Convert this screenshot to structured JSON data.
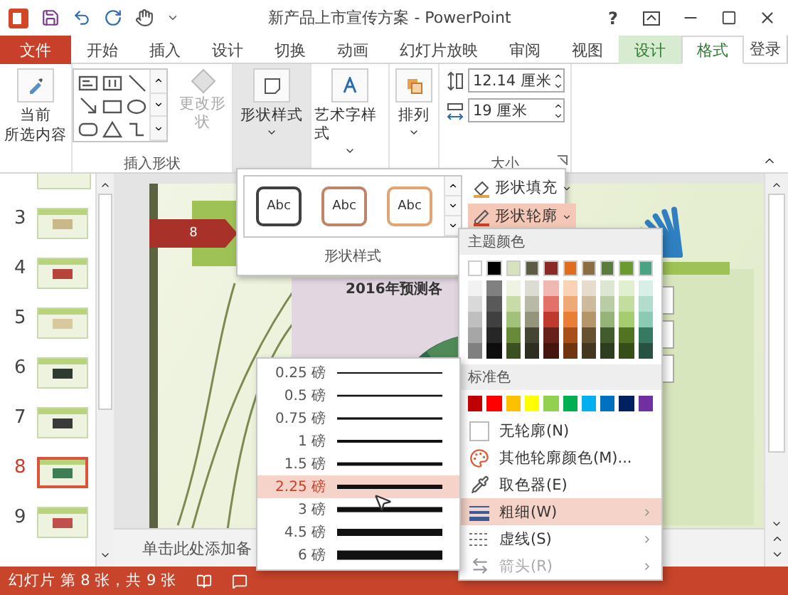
{
  "window": {
    "title": "新产品上市宣传方案 - PowerPoint",
    "help": "?"
  },
  "ribbon_tabs": [
    {
      "label": "文件",
      "kind": "file",
      "selected": false
    },
    {
      "label": "开始",
      "kind": "normal",
      "selected": false
    },
    {
      "label": "插入",
      "kind": "normal",
      "selected": false
    },
    {
      "label": "设计",
      "kind": "normal",
      "selected": false
    },
    {
      "label": "切换",
      "kind": "normal",
      "selected": false
    },
    {
      "label": "动画",
      "kind": "normal",
      "selected": false
    },
    {
      "label": "幻灯片放映",
      "kind": "normal",
      "selected": false
    },
    {
      "label": "审阅",
      "kind": "normal",
      "selected": false
    },
    {
      "label": "视图",
      "kind": "normal",
      "selected": false
    },
    {
      "label": "设计",
      "kind": "contextual",
      "selected": false
    },
    {
      "label": "格式",
      "kind": "contextual",
      "selected": true
    }
  ],
  "account": {
    "label": "登录"
  },
  "ribbon": {
    "current_selection": {
      "lines": [
        "当前",
        "所选内容"
      ]
    },
    "insert_shapes": {
      "title": "插入形状",
      "change_shape": {
        "label": "更改形状",
        "disabled": true
      }
    },
    "shape_styles": {
      "label": "形状样式",
      "pressed": true
    },
    "wordart_styles": {
      "label": "艺术字样式",
      "pressed": false
    },
    "arrange": {
      "label": "排列",
      "pressed": false
    },
    "size": {
      "title": "大小",
      "height": "12.14 厘米",
      "width": "19 厘米"
    }
  },
  "slides": [
    {
      "number": "3",
      "selected": false
    },
    {
      "number": "4",
      "selected": false
    },
    {
      "number": "5",
      "selected": false
    },
    {
      "number": "6",
      "selected": false
    },
    {
      "number": "7",
      "selected": false
    },
    {
      "number": "8",
      "selected": true
    },
    {
      "number": "9",
      "selected": false
    }
  ],
  "slide": {
    "tag": "8",
    "chart_title": "2016年预测各"
  },
  "notes": {
    "placeholder": "单击此处添加备"
  },
  "status_bar": {
    "slide_info": "幻灯片 第 8 张，共 9 张"
  },
  "style_gallery": {
    "title": "形状样式",
    "styles": [
      {
        "label": "Abc",
        "color": "#404040"
      },
      {
        "label": "Abc",
        "color": "#c08468"
      },
      {
        "label": "Abc",
        "color": "#e2a472"
      }
    ],
    "shape_fill": {
      "label": "形状填充",
      "expanded": false
    },
    "shape_outline": {
      "label": "形状轮廓",
      "expanded": true
    }
  },
  "outline_menu": {
    "theme_title": "主题颜色",
    "theme_colors": [
      {
        "color": "#ffffff",
        "shades": [
          {
            "color": "#f2f2f2"
          },
          {
            "color": "#d9d9d9"
          },
          {
            "color": "#bfbfbf"
          },
          {
            "color": "#a6a6a6"
          },
          {
            "color": "#808080"
          }
        ]
      },
      {
        "color": "#000000",
        "shades": [
          {
            "color": "#808080"
          },
          {
            "color": "#595959"
          },
          {
            "color": "#404040"
          },
          {
            "color": "#262626"
          },
          {
            "color": "#0d0d0d"
          }
        ]
      },
      {
        "color": "#d6e3bc",
        "shades": [
          {
            "color": "#eef3e3"
          },
          {
            "color": "#c9dba8"
          },
          {
            "color": "#a2c17a"
          },
          {
            "color": "#6a8a3b"
          },
          {
            "color": "#3c4f21"
          }
        ]
      },
      {
        "color": "#5c5c44",
        "shades": [
          {
            "color": "#dcdcd3"
          },
          {
            "color": "#b9b9a8"
          },
          {
            "color": "#95957c"
          },
          {
            "color": "#454533"
          },
          {
            "color": "#2e2e22"
          }
        ]
      },
      {
        "color": "#8b2a24",
        "shades": [
          {
            "color": "#f1b7b2"
          },
          {
            "color": "#e4706a"
          },
          {
            "color": "#c0392f"
          },
          {
            "color": "#68201b"
          },
          {
            "color": "#45150f"
          }
        ]
      },
      {
        "color": "#e06d1e",
        "shades": [
          {
            "color": "#f8d3b8"
          },
          {
            "color": "#f1a877"
          },
          {
            "color": "#e97f37"
          },
          {
            "color": "#a85017"
          },
          {
            "color": "#70350f"
          }
        ]
      },
      {
        "color": "#8a6d42",
        "shades": [
          {
            "color": "#e6dccd"
          },
          {
            "color": "#cdb99b"
          },
          {
            "color": "#b4966a"
          },
          {
            "color": "#675131"
          },
          {
            "color": "#453621"
          }
        ]
      },
      {
        "color": "#5a7a3e",
        "shades": [
          {
            "color": "#dce6d2"
          },
          {
            "color": "#b9cca5"
          },
          {
            "color": "#96b378"
          },
          {
            "color": "#435c2e"
          },
          {
            "color": "#2d3d1f"
          }
        ]
      },
      {
        "color": "#6c9a2e",
        "shades": [
          {
            "color": "#e1eecf"
          },
          {
            "color": "#c3dd9f"
          },
          {
            "color": "#a5cc6f"
          },
          {
            "color": "#517322"
          },
          {
            "color": "#364d17"
          }
        ]
      },
      {
        "color": "#4aa383",
        "shades": [
          {
            "color": "#d8eee6"
          },
          {
            "color": "#b2ddcd"
          },
          {
            "color": "#8bcbb4"
          },
          {
            "color": "#377a62"
          },
          {
            "color": "#255241"
          }
        ]
      }
    ],
    "standard_title": "标准色",
    "standard_colors": [
      {
        "color": "#c00000"
      },
      {
        "color": "#ff0000"
      },
      {
        "color": "#ffc000"
      },
      {
        "color": "#ffff00"
      },
      {
        "color": "#92d050"
      },
      {
        "color": "#00b050"
      },
      {
        "color": "#00b0f0"
      },
      {
        "color": "#0070c0"
      },
      {
        "color": "#002060"
      },
      {
        "color": "#7030a0"
      }
    ],
    "items": [
      {
        "label": "无轮廓(N)",
        "kind": "none",
        "highlighted": false,
        "disabled": false,
        "submenu": false
      },
      {
        "label": "其他轮廓颜色(M)...",
        "kind": "palette",
        "highlighted": false,
        "disabled": false,
        "submenu": false
      },
      {
        "label": "取色器(E)",
        "kind": "eyedropper",
        "highlighted": false,
        "disabled": false,
        "submenu": false
      },
      {
        "label": "粗细(W)",
        "kind": "weight",
        "highlighted": true,
        "disabled": false,
        "submenu": true
      },
      {
        "label": "虚线(S)",
        "kind": "dash",
        "highlighted": false,
        "disabled": false,
        "submenu": true
      },
      {
        "label": "箭头(R)",
        "kind": "arrows",
        "highlighted": false,
        "disabled": true,
        "submenu": true
      }
    ]
  },
  "weight_menu": {
    "items": [
      {
        "label": "0.25 磅",
        "selected": false
      },
      {
        "label": "0.5 磅",
        "selected": false
      },
      {
        "label": "0.75 磅",
        "selected": false
      },
      {
        "label": "1 磅",
        "selected": false
      },
      {
        "label": "1.5 磅",
        "selected": false
      },
      {
        "label": "2.25 磅",
        "selected": true
      },
      {
        "label": "3 磅",
        "selected": false
      },
      {
        "label": "4.5 磅",
        "selected": false
      },
      {
        "label": "6 磅",
        "selected": false
      }
    ]
  }
}
